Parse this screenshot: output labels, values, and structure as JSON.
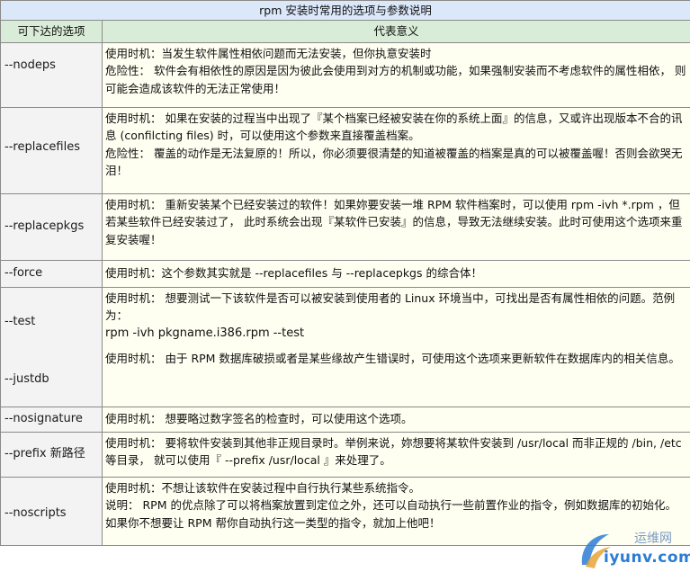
{
  "table": {
    "caption": "rpm 安装时常用的选项与参数说明",
    "col_option": "可下达的选项",
    "col_meaning": "代表意义",
    "rows": [
      {
        "opt_a": "--nodeps",
        "lines": [
          "使用时机：当发生软件属性相依问题而无法安装，但你执意安装时",
          "危险性： 软件会有相依性的原因是因为彼此会使用到对方的机制或功能，如果强制安装而不考虑软件的属性相依， 则可能会造成该软件的无法正常使用！"
        ]
      },
      {
        "opt_a": "--replacefiles",
        "lines": [
          "使用时机： 如果在安装的过程当中出现了『某个档案已经被安装在你的系统上面』的信息，又或许出现版本不合的讯息 (confilcting files) 时，可以使用这个参数来直接覆盖档案。",
          "危险性： 覆盖的动作是无法复原的！所以，你必须要很清楚的知道被覆盖的档案是真的可以被覆盖喔！否则会欲哭无泪！"
        ]
      },
      {
        "opt_a": "--replacepkgs",
        "lines": [
          "使用时机： 重新安装某个已经安装过的软件！如果妳要安装一堆 RPM 软件档案时，可以使用 rpm -ivh *.rpm ，但若某些软件已经安装过了， 此时系统会出现『某软件已安装』的信息，导致无法继续安装。此时可使用这个选项来重复安装喔！"
        ]
      },
      {
        "opt_a": "--force",
        "lines": [
          "使用时机：这个参数其实就是 --replacefiles 与 --replacepkgs 的综合体！"
        ]
      },
      {
        "opt_a": "--test",
        "opt_b": "--justdb",
        "lines": [
          "使用时机： 想要测试一下该软件是否可以被安装到使用者的 Linux 环境当中，可找出是否有属性相依的问题。范例为：",
          "rpm -ivh pkgname.i386.rpm --test",
          "使用时机： 由于 RPM 数据库破损或者是某些缘故产生错误时，可使用这个选项来更新软件在数据库内的相关信息。"
        ]
      },
      {
        "opt_a": "--nosignature",
        "lines": [
          "使用时机： 想要略过数字签名的检查时，可以使用这个选项。"
        ]
      },
      {
        "opt_a": "--prefix 新路径",
        "lines": [
          "使用时机： 要将软件安装到其他非正规目录时。举例来说，妳想要将某软件安装到 /usr/local 而非正规的 /bin, /etc 等目录， 就可以使用『 --prefix /usr/local 』来处理了。"
        ]
      },
      {
        "opt_a": "--noscripts",
        "lines": [
          "使用时机：不想让该软件在安装过程中自行执行某些系统指令。",
          "说明： RPM 的优点除了可以将档案放置到定位之外，还可以自动执行一些前置作业的指令，例如数据库的初始化。 如果你不想要让 RPM 帮你自动执行这一类型的指令，就加上他吧！"
        ]
      }
    ]
  },
  "watermark": {
    "site": "iyunv.com",
    "cn": "运维网",
    "icon": "logo-swoosh-icon",
    "color": "#2b7cd3"
  }
}
